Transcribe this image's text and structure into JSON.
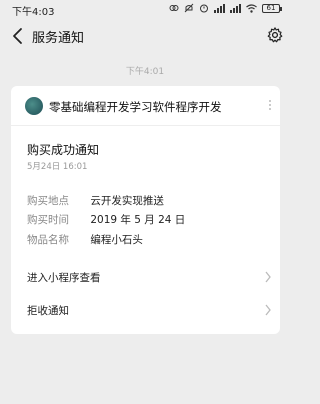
{
  "status_bar": {
    "time": "下午4:03",
    "battery": "61"
  },
  "header": {
    "title": "服务通知"
  },
  "message": {
    "timestamp": "下午4:01",
    "app_name": "零基础编程开发学习软件程序开发",
    "notice_title": "购买成功通知",
    "notice_date": "5月24日  16:01",
    "fields": [
      {
        "label": "购买地点",
        "value": "云开发实现推送"
      },
      {
        "label": "购买时间",
        "value": "2019 年 5 月 24 日"
      },
      {
        "label": "物品名称",
        "value": "编程小石头"
      }
    ],
    "actions": [
      {
        "label": "进入小程序查看"
      },
      {
        "label": "拒收通知"
      }
    ]
  }
}
